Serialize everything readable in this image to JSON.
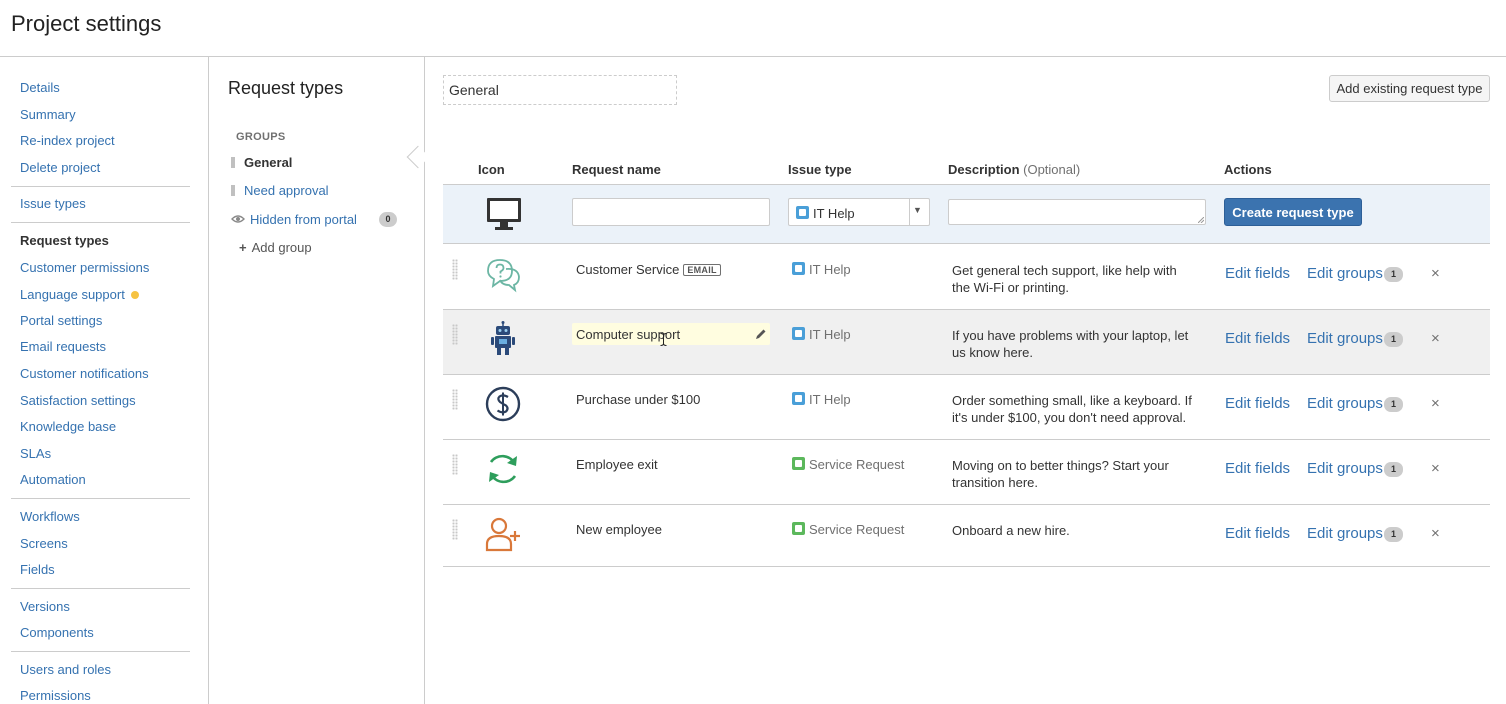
{
  "page": {
    "title": "Project settings"
  },
  "nav": {
    "items": [
      {
        "label": "Details"
      },
      {
        "label": "Summary"
      },
      {
        "label": "Re-index project"
      },
      {
        "label": "Delete project"
      },
      {
        "label": "Issue types"
      },
      {
        "label": "Request types",
        "active": true
      },
      {
        "label": "Customer permissions"
      },
      {
        "label": "Language support"
      },
      {
        "label": "Portal settings"
      },
      {
        "label": "Email requests"
      },
      {
        "label": "Customer notifications"
      },
      {
        "label": "Satisfaction settings"
      },
      {
        "label": "Knowledge base"
      },
      {
        "label": "SLAs"
      },
      {
        "label": "Automation"
      },
      {
        "label": "Workflows"
      },
      {
        "label": "Screens"
      },
      {
        "label": "Fields"
      },
      {
        "label": "Versions"
      },
      {
        "label": "Components"
      },
      {
        "label": "Users and roles"
      },
      {
        "label": "Permissions"
      }
    ]
  },
  "groups_panel": {
    "title": "Request types",
    "heading": "GROUPS",
    "groups": [
      {
        "label": "General",
        "active": true
      },
      {
        "label": "Need approval"
      }
    ],
    "hidden": {
      "label": "Hidden from portal",
      "count": "0"
    },
    "add_group": "Add group"
  },
  "main": {
    "group_name": "General",
    "add_existing_label": "Add existing request type",
    "columns": {
      "icon": "Icon",
      "name": "Request name",
      "issue_type": "Issue type",
      "description": "Description",
      "description_optional": "(Optional)",
      "actions": "Actions"
    },
    "create_row": {
      "name_value": "",
      "issue_type": "IT Help",
      "description_value": "",
      "create_label": "Create request type"
    },
    "rows": [
      {
        "icon": "question-chat-icon",
        "name": "Customer Service",
        "badge": "EMAIL",
        "issue_type": "IT Help",
        "description": "Get general tech support, like help with the Wi-Fi or printing.",
        "edit_fields": "Edit fields",
        "edit_groups": "Edit groups",
        "groups_count": "1",
        "delete": "×"
      },
      {
        "icon": "robot-icon",
        "name": "Computer support",
        "issue_type": "IT Help",
        "description": "If you have problems with your laptop, let us know here.",
        "edit_fields": "Edit fields",
        "edit_groups": "Edit groups",
        "groups_count": "1",
        "delete": "×"
      },
      {
        "icon": "dollar-icon",
        "name": "Purchase under $100",
        "issue_type": "IT Help",
        "description": "Order something small, like a keyboard. If it's under $100, you don't need approval.",
        "edit_fields": "Edit fields",
        "edit_groups": "Edit groups",
        "groups_count": "1",
        "delete": "×"
      },
      {
        "icon": "refresh-arrows-icon",
        "name": "Employee exit",
        "issue_type": "Service Request",
        "description": "Moving on to better things? Start your transition here.",
        "edit_fields": "Edit fields",
        "edit_groups": "Edit groups",
        "groups_count": "1",
        "delete": "×"
      },
      {
        "icon": "add-person-icon",
        "name": "New employee",
        "issue_type": "Service Request",
        "description": "Onboard a new hire.",
        "edit_fields": "Edit fields",
        "edit_groups": "Edit groups",
        "groups_count": "1",
        "delete": "×"
      }
    ]
  },
  "colors": {
    "link": "#3572b0",
    "primary_button": "#3b73af",
    "it_help_icon": "#4a9fd8",
    "service_request_icon": "#5cb85c",
    "create_row_bg": "#ebf2f9",
    "language_dot": "#f6c342"
  }
}
